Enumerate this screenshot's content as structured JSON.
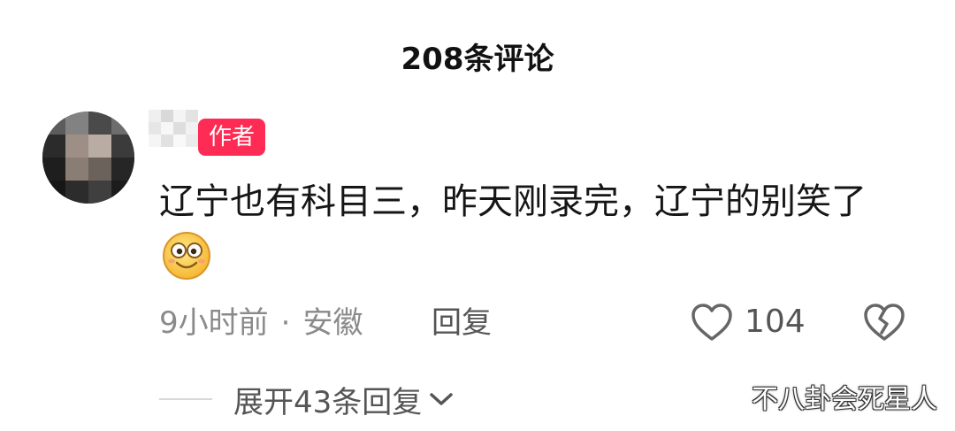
{
  "header": {
    "title": "208条评论"
  },
  "comment": {
    "author_badge": "作者",
    "text": "辽宁也有科目三，昨天刚录完，辽宁的别笑了",
    "emoji_icon": "smiley-face-icon",
    "time": "9小时前",
    "separator": "·",
    "location": "安徽",
    "reply_label": "回复",
    "like_count": "104",
    "like_icon": "heart-outline-icon",
    "dislike_icon": "broken-heart-icon"
  },
  "replies": {
    "expand_label": "展开43条回复",
    "expand_icon": "chevron-down-icon"
  },
  "watermark": {
    "text": "不八卦会死星人"
  },
  "colors": {
    "badge": "#fe2c55",
    "muted_text": "#8a8a8a",
    "primary_text": "#161616"
  }
}
